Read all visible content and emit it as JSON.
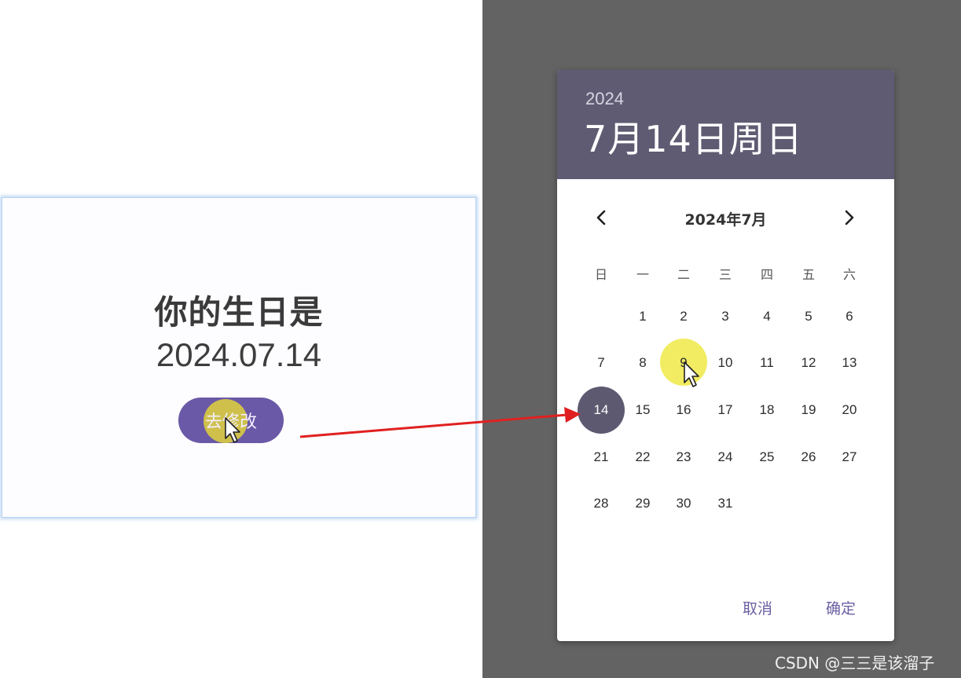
{
  "left_screen": {
    "title": "你的生日是",
    "date_value": "2024.07.14",
    "modify_button_label": "去修改"
  },
  "date_picker": {
    "header_year": "2024",
    "header_date": "7月14日周日",
    "month_label": "2024年7月",
    "prev_icon": "chevron-left-icon",
    "next_icon": "chevron-right-icon",
    "weekdays": [
      "日",
      "一",
      "二",
      "三",
      "四",
      "五",
      "六"
    ],
    "days": [
      [
        "",
        "1",
        "2",
        "3",
        "4",
        "5",
        "6"
      ],
      [
        "7",
        "8",
        "9",
        "10",
        "11",
        "12",
        "13"
      ],
      [
        "14",
        "15",
        "16",
        "17",
        "18",
        "19",
        "20"
      ],
      [
        "21",
        "22",
        "23",
        "24",
        "25",
        "26",
        "27"
      ],
      [
        "28",
        "29",
        "30",
        "31",
        "",
        "",
        ""
      ]
    ],
    "selected_day": "14",
    "cancel_label": "取消",
    "ok_label": "确定"
  },
  "colors": {
    "accent_button": "#6a59a7",
    "header_background": "#5f5b72",
    "selected_day": "#5d5970",
    "click_highlight": "#e8e04a",
    "arrow": "#e02020"
  },
  "watermark": "CSDN @三三是该溜子"
}
